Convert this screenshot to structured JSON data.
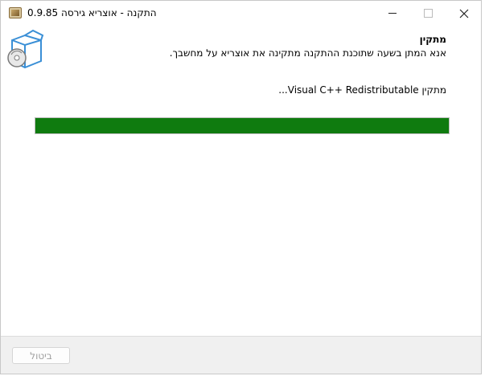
{
  "window": {
    "title": "התקנה - אוצריא גירסה 0.9.85"
  },
  "header": {
    "heading": "מתקין",
    "subtext": "אנא המתן בשעה שתוכנת ההתקנה מתקינה את אוצריא על מחשבך."
  },
  "main": {
    "status": "מתקין Visual C++ Redistributable...",
    "progress_percent": 100,
    "progress_color": "#0f7b0f"
  },
  "footer": {
    "cancel_label": "ביטול"
  },
  "icons": {
    "app": "installer-box-icon",
    "header": "setup-box-disc-icon"
  }
}
